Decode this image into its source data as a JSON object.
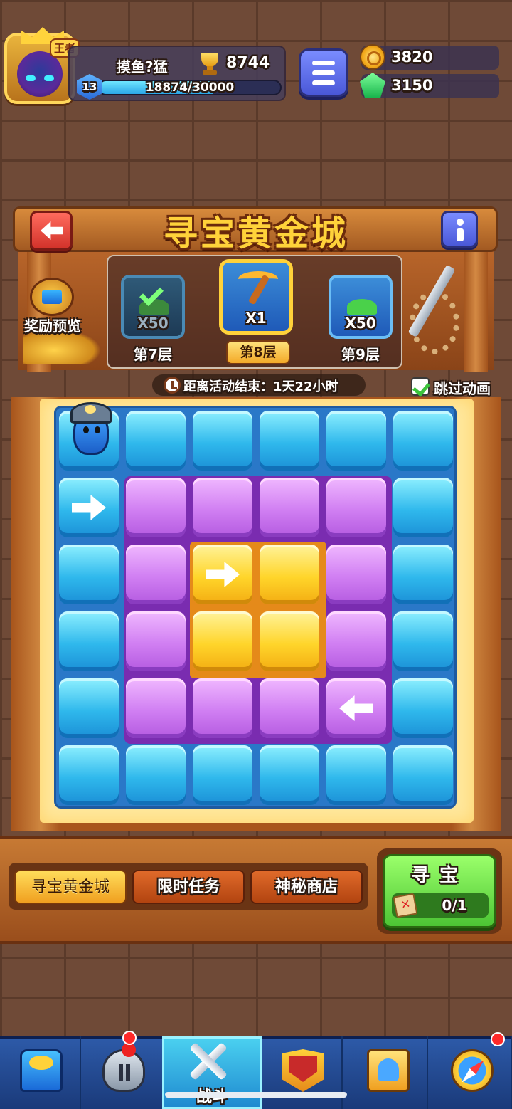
{
  "player": {
    "name": "摸鱼?猛",
    "avatar_badge": "王者",
    "trophies": "8744",
    "level": "13",
    "xp_text": "18874/30000",
    "xp_progress": 0.629
  },
  "resources": {
    "coins": "3820",
    "gems": "3150"
  },
  "event": {
    "title": "寻宝黄金城",
    "reward_preview_label": "奖励预览",
    "floors": [
      {
        "count": "X50",
        "label": "第7层",
        "state": "completed"
      },
      {
        "count": "X1",
        "label": "第8层",
        "state": "current"
      },
      {
        "count": "X50",
        "label": "第9层",
        "state": "locked"
      }
    ],
    "timer_text": "距离活动结束：1天22小时",
    "skip_animation_label": "跳过动画",
    "skip_animation_checked": true
  },
  "board": {
    "rows": [
      [
        "blue-miner",
        "blue",
        "blue",
        "blue",
        "blue",
        "blue"
      ],
      [
        "blue-arrow-right",
        "purple",
        "purple",
        "purple",
        "purple",
        "blue"
      ],
      [
        "blue",
        "purple",
        "gold-arrow-right",
        "gold",
        "purple",
        "blue"
      ],
      [
        "blue",
        "purple",
        "gold",
        "gold",
        "purple",
        "blue"
      ],
      [
        "blue",
        "purple",
        "purple",
        "purple",
        "purple-arrow-left",
        "blue"
      ],
      [
        "blue",
        "blue",
        "blue",
        "blue",
        "blue",
        "blue"
      ]
    ]
  },
  "tabs": [
    {
      "label": "寻宝黄金城",
      "active": true
    },
    {
      "label": "限时任务",
      "active": false
    },
    {
      "label": "神秘商店",
      "active": false
    }
  ],
  "search": {
    "label": "寻宝",
    "count": "0/1"
  },
  "nav": {
    "items": [
      {
        "name": "treasure",
        "label": ""
      },
      {
        "name": "heroes",
        "label": ""
      },
      {
        "name": "battle",
        "label": "战斗"
      },
      {
        "name": "arena",
        "label": ""
      },
      {
        "name": "guild",
        "label": ""
      },
      {
        "name": "explore",
        "label": ""
      }
    ]
  },
  "colors": {
    "title_gold": "#ffd23a",
    "tile_blue": "#2fb8ec",
    "tile_purple": "#d07ef2",
    "tile_gold": "#ffd52a",
    "search_green": "#4cc434",
    "notification_red": "#ff2a2a"
  }
}
